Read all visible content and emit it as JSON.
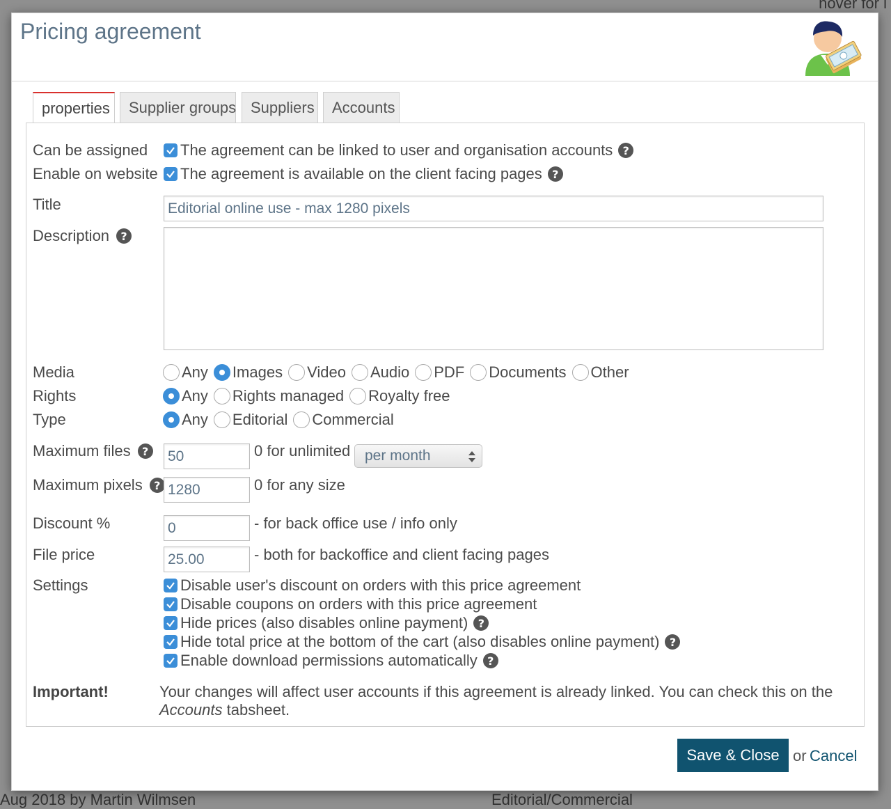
{
  "background": {
    "top_right_text": "hover for i",
    "bottom_left_text": "Aug 2018 by Martin Wilmsen",
    "bottom_center_text": "Editorial/Commercial"
  },
  "dialog": {
    "title": "Pricing agreement",
    "header_icon": "user-with-money-icon"
  },
  "tabs": [
    {
      "label": "properties",
      "active": true
    },
    {
      "label": "Supplier groups",
      "active": false
    },
    {
      "label": "Suppliers",
      "active": false
    },
    {
      "label": "Accounts",
      "active": false
    }
  ],
  "form": {
    "can_be_assigned": {
      "label": "Can be assigned",
      "text": "The agreement can be linked to user and organisation accounts",
      "checked": true
    },
    "enable_on_website": {
      "label": "Enable on website",
      "text": "The agreement is available on the client facing pages",
      "checked": true
    },
    "title": {
      "label": "Title",
      "value": "Editorial online use - max 1280 pixels"
    },
    "description": {
      "label": "Description",
      "value": ""
    },
    "media": {
      "label": "Media",
      "options": [
        "Any",
        "Images",
        "Video",
        "Audio",
        "PDF",
        "Documents",
        "Other"
      ],
      "selected": "Images"
    },
    "rights": {
      "label": "Rights",
      "options": [
        "Any",
        "Rights managed",
        "Royalty free"
      ],
      "selected": "Any"
    },
    "type": {
      "label": "Type",
      "options": [
        "Any",
        "Editorial",
        "Commercial"
      ],
      "selected": "Any"
    },
    "max_files": {
      "label": "Maximum files",
      "value": "50",
      "hint": "0 for unlimited",
      "period": "per month"
    },
    "max_pixels": {
      "label": "Maximum pixels",
      "value": "1280",
      "hint": "0 for any size"
    },
    "discount": {
      "label": "Discount %",
      "value": "0",
      "hint": "- for back office use / info only"
    },
    "file_price": {
      "label": "File price",
      "value": "25.00",
      "hint": "- both for backoffice and client facing pages"
    },
    "settings": {
      "label": "Settings",
      "items": [
        {
          "text": "Disable user's discount on orders with this price agreement",
          "checked": true,
          "help": false
        },
        {
          "text": "Disable coupons on orders with this price agreement",
          "checked": true,
          "help": false
        },
        {
          "text": "Hide prices (also disables online payment)",
          "checked": true,
          "help": true
        },
        {
          "text": "Hide total price at the bottom of the cart (also disables online payment)",
          "checked": true,
          "help": true
        },
        {
          "text": "Enable download permissions automatically",
          "checked": true,
          "help": true
        }
      ]
    },
    "important": {
      "label": "Important!",
      "text_before": "Your changes will affect user accounts if this agreement is already linked. You can check this on the ",
      "text_em": "Accounts",
      "text_after": " tabsheet."
    }
  },
  "footer": {
    "save_label": "Save & Close",
    "or_text": "or",
    "cancel_label": "Cancel"
  },
  "colors": {
    "accent": "#3b8ed8",
    "save_button": "#10536f",
    "title": "#5d7488",
    "active_tab_border": "#d9302d"
  }
}
